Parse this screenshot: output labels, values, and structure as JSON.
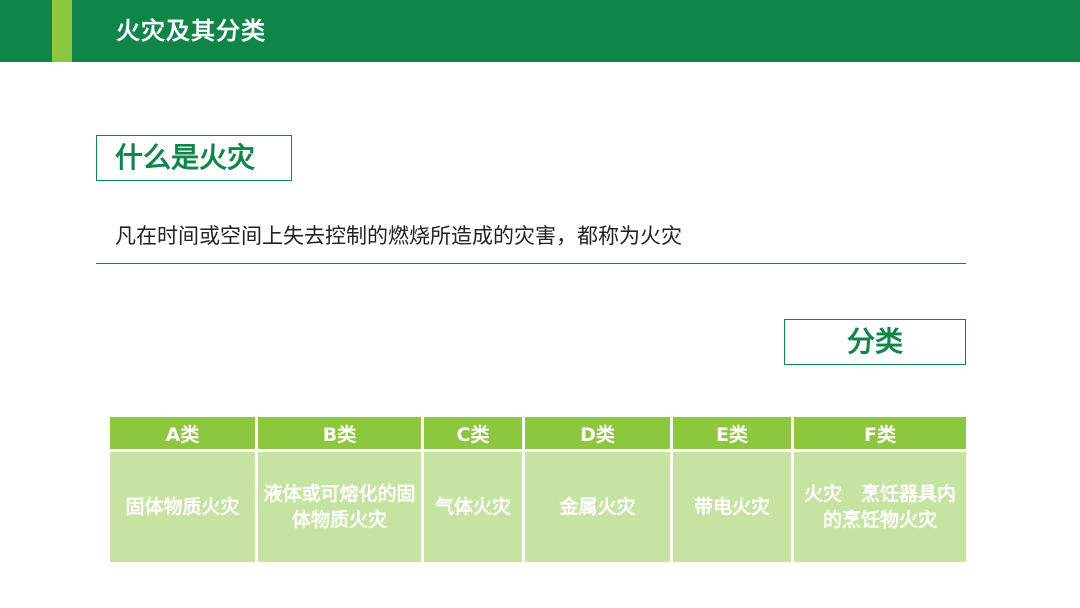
{
  "header": {
    "title": "火灾及其分类"
  },
  "section_what": {
    "heading": "什么是火灾",
    "definition": "凡在时间或空间上失去控制的燃烧所造成的灾害，都称为火灾"
  },
  "section_classes": {
    "heading": "分类",
    "columns": [
      "A类",
      "B类",
      "C类",
      "D类",
      "E类",
      "F类"
    ],
    "descriptions": [
      "固体物质火灾",
      "液体或可熔化的固体物质火灾",
      "气体火灾",
      "金属火灾",
      "带电火灾",
      "火灾　烹饪器具内的烹饪物火灾"
    ]
  },
  "colors": {
    "primary_green": "#10854a",
    "accent_lime": "#8dc63f",
    "cell_light_green": "#c6e3a1"
  }
}
